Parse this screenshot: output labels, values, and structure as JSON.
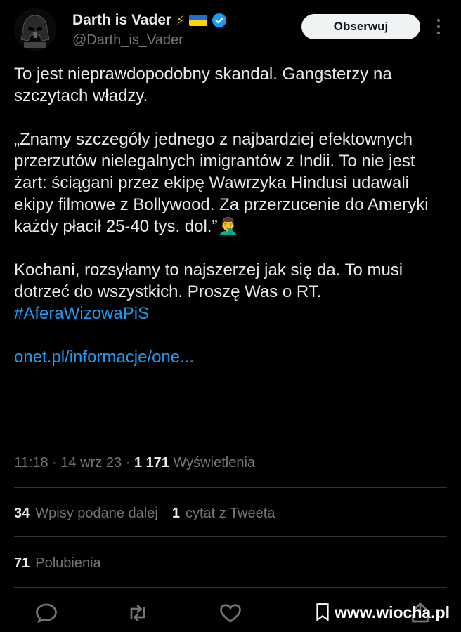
{
  "author": {
    "name": "Darth is Vader",
    "bolt": "⚡",
    "handle": "@Darth_is_Vader"
  },
  "follow_label": "Obserwuj",
  "tweet": {
    "line1": "To jest nieprawdopodobny skandal. Gangsterzy na szczytach władzy.",
    "quote": "„Znamy szczegóły jednego z najbardziej efektownych przerzutów nielegalnych imigrantów z Indii. To nie jest żart: ściągani przez ekipę Wawrzyka Hindusi udawali ekipy filmowe z Bollywood. Za przerzucenie do Ameryki każdy płacił 25-40 tys. dol.”",
    "facepalm": "🤦‍♂️",
    "appeal": "Kochani, rozsyłamy to najszerzej jak się da. To musi dotrzeć do wszystkich. Proszę Was o RT.",
    "hashtag": "#AferaWizowaPiS",
    "link": "onet.pl/informacje/one..."
  },
  "meta": {
    "time": "11:18",
    "date": "14 wrz 23",
    "views": "1 171",
    "views_label": "Wyświetlenia"
  },
  "stats": {
    "retweets": "34",
    "retweets_label": "Wpisy podane dalej",
    "quotes": "1",
    "quotes_label": "cytat z Tweeta",
    "likes": "71",
    "likes_label": "Polubienia"
  },
  "icons": [
    "reply-icon",
    "retweet-icon",
    "like-icon",
    "bookmark-icon",
    "share-icon"
  ],
  "watermark": "www.wiocha.pl",
  "colors": {
    "background": "#000000",
    "text": "#e7e9ea",
    "muted": "#71767b",
    "link": "#1d9bf0",
    "divider": "#2f3336"
  }
}
